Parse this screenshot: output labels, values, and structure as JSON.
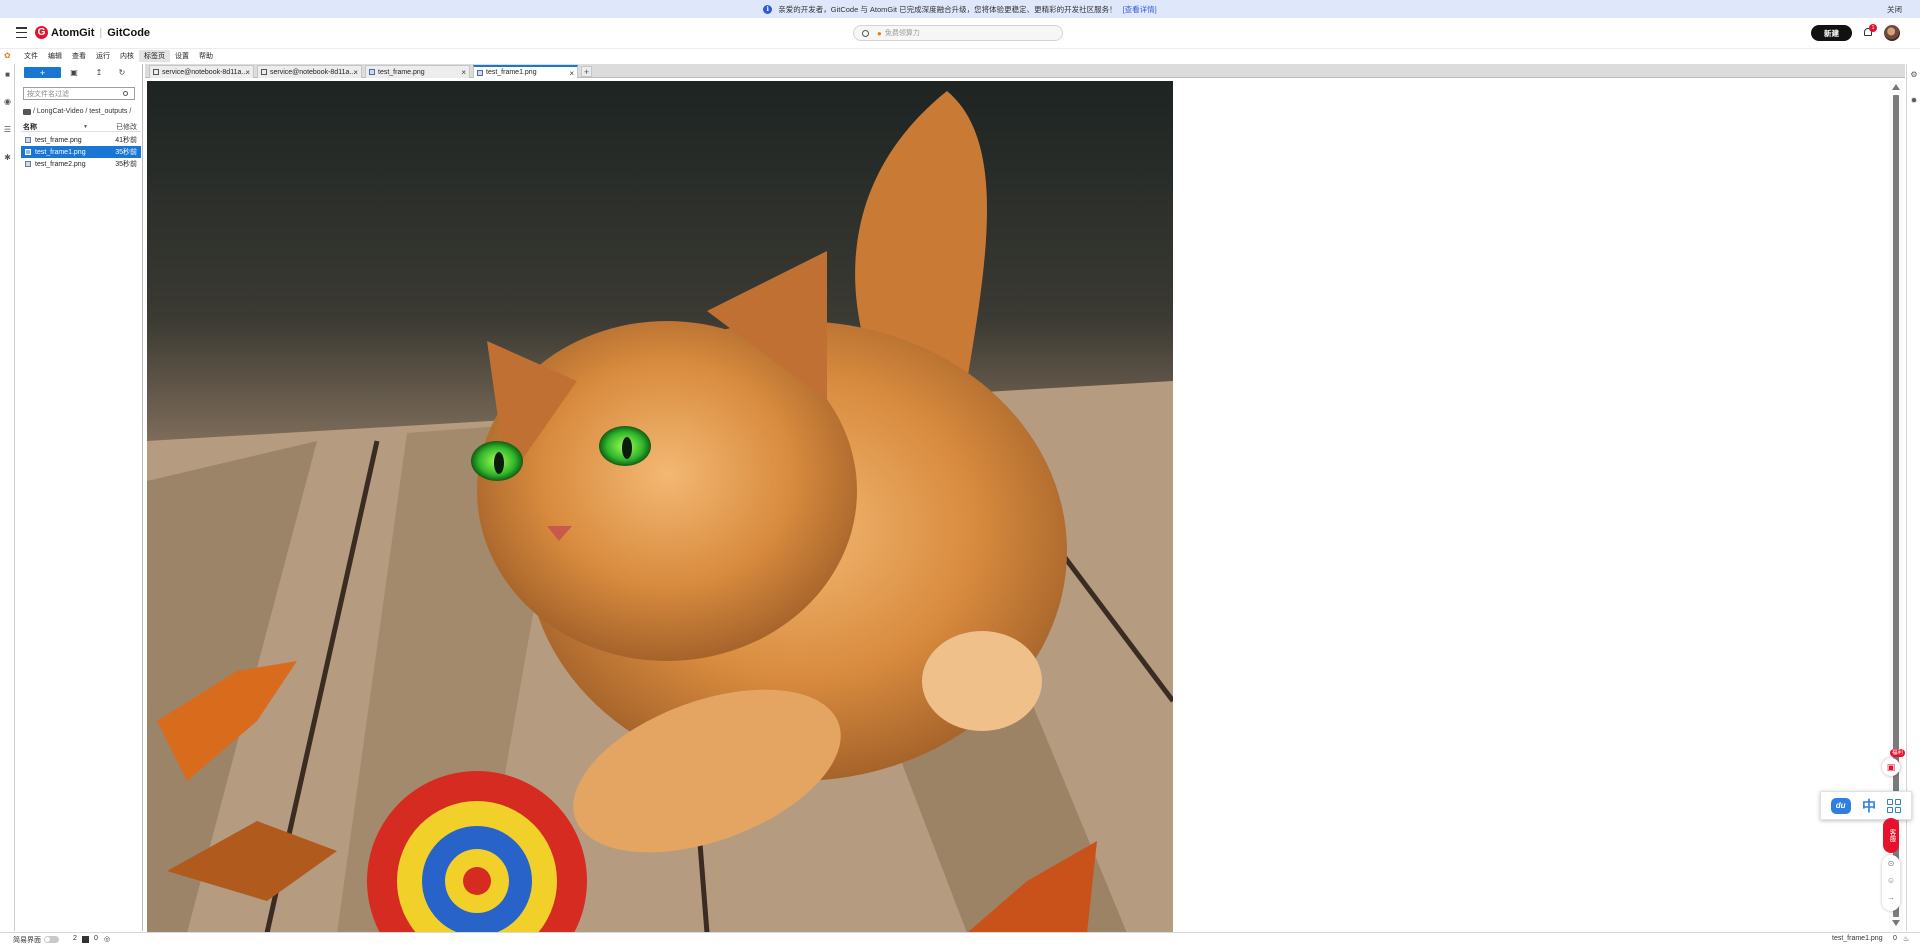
{
  "banner": {
    "message": "亲爱的开发者，GitCode 与 AtomGit 已完成深度融合升级，您将体验更稳定、更精彩的开发社区服务！",
    "link": "[查看详情]",
    "close": "关闭"
  },
  "header": {
    "brand_left": "AtomGit",
    "brand_right": "GitCode",
    "search_placeholder": "免费领算力",
    "new_button": "新建",
    "notification_count": "1"
  },
  "menubar": {
    "items": [
      "文件",
      "编辑",
      "查看",
      "运行",
      "内核",
      "标签页",
      "设置",
      "帮助"
    ],
    "active_index": 5
  },
  "filebrowser": {
    "new_label": "+",
    "filter_placeholder": "按文件名过滤",
    "breadcrumb": "/ LongCat-Video / test_outputs /",
    "col_name": "名称",
    "col_modified": "已修改",
    "files": [
      {
        "name": "test_frame.png",
        "modified": "41秒前",
        "selected": false
      },
      {
        "name": "test_frame1.png",
        "modified": "35秒前",
        "selected": true
      },
      {
        "name": "test_frame2.png",
        "modified": "35秒前",
        "selected": false
      }
    ]
  },
  "tabs": [
    {
      "label": "service@notebook-8d11a...",
      "type": "terminal",
      "active": false
    },
    {
      "label": "service@notebook-8d11a...",
      "type": "terminal",
      "active": false
    },
    {
      "label": "test_frame.png",
      "type": "image",
      "active": false
    },
    {
      "label": "test_frame1.png",
      "type": "image",
      "active": true
    }
  ],
  "floating": {
    "gift_badge": "福利",
    "service_label": "客服"
  },
  "statusbar": {
    "mode_label": "简易界面",
    "terminal_count": "2",
    "kernel_count": "0",
    "current_file": "test_frame1.png",
    "notifications": "0"
  },
  "colors": {
    "accent": "#1976d2",
    "brand_red": "#e8112d",
    "banner_bg": "#dfe7fb"
  }
}
